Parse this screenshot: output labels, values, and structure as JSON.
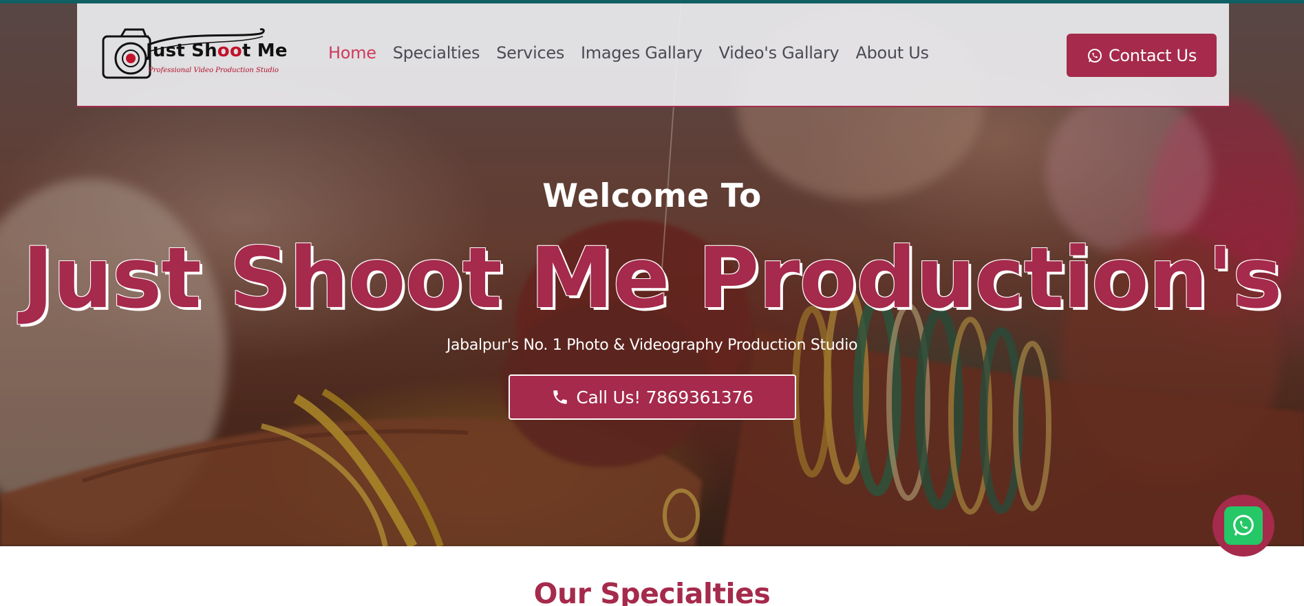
{
  "brand": {
    "logo_title_part1": "Just Sh",
    "logo_title_oo": "oo",
    "logo_title_part2": "t Me",
    "logo_tagline": "Professional Video Production Studio",
    "accent_color": "#a52a4b",
    "top_strip_color": "#0f5f63"
  },
  "nav": {
    "items": [
      {
        "label": "Home",
        "active": true
      },
      {
        "label": "Specialties",
        "active": false
      },
      {
        "label": "Services",
        "active": false
      },
      {
        "label": "Images Gallary",
        "active": false
      },
      {
        "label": "Video's Gallary",
        "active": false
      },
      {
        "label": "About Us",
        "active": false
      }
    ],
    "contact_label": "Contact Us",
    "contact_icon": "whatsapp-icon"
  },
  "hero": {
    "welcome": "Welcome To",
    "title": "Just Shoot Me Production's",
    "subtitle": "Jabalpur's No. 1 Photo & Videography Production Studio",
    "call_label": "Call Us! 7869361376",
    "call_icon": "phone-icon"
  },
  "floating": {
    "icon": "whatsapp-icon",
    "color": "#25c766"
  },
  "section": {
    "title": "Our Specialties"
  }
}
